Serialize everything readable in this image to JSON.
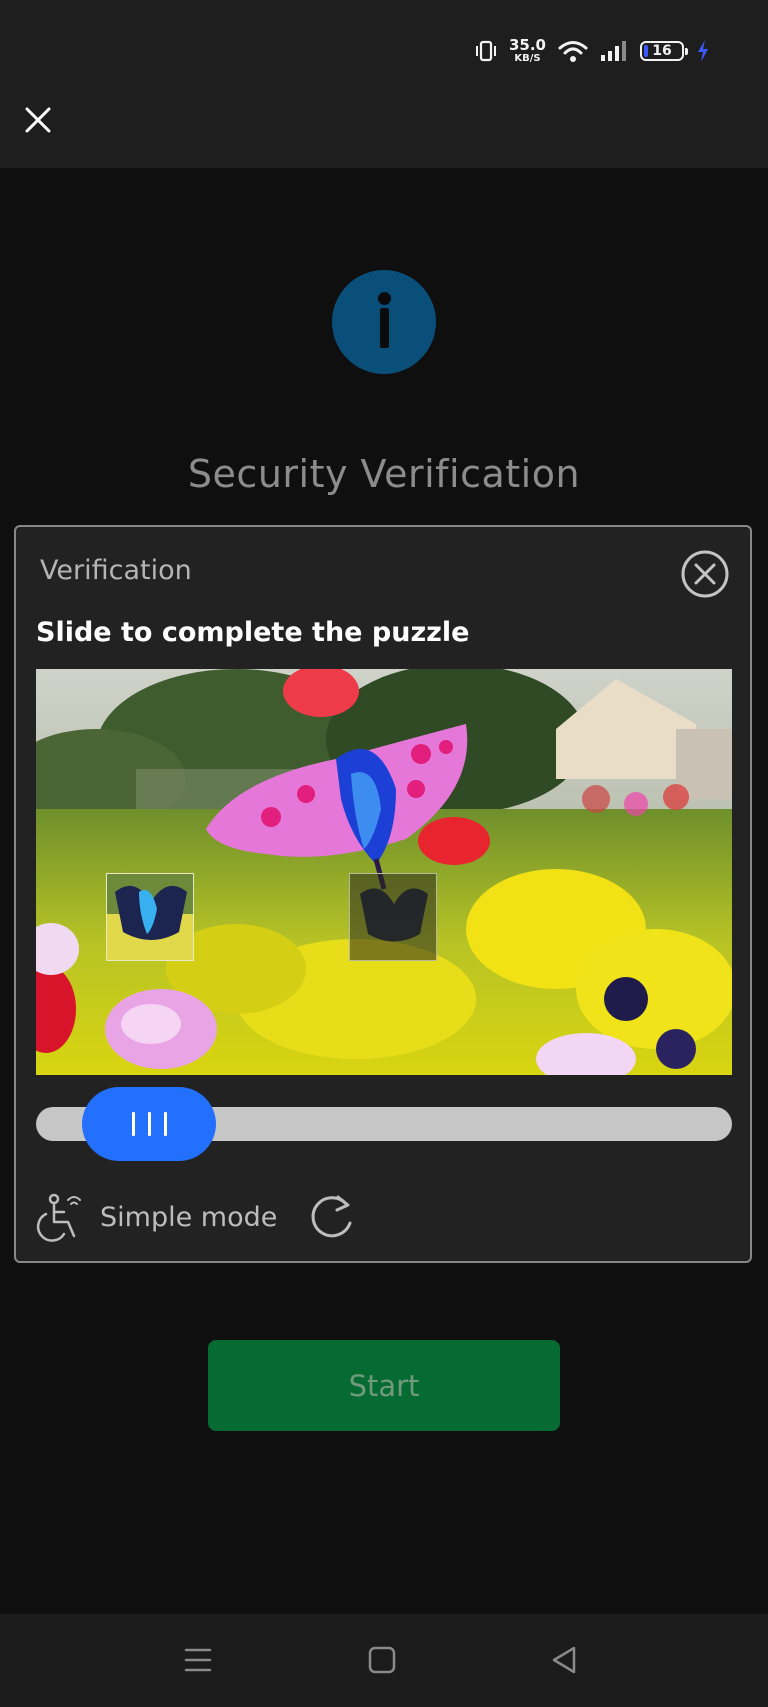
{
  "status_bar": {
    "network_speed_value": "35.0",
    "network_speed_unit": "KB/S",
    "battery_level": "16",
    "icons": [
      "vibrate-icon",
      "wifi-icon",
      "signal-icon",
      "battery-icon",
      "charging-icon"
    ]
  },
  "header": {
    "close_icon": "close-icon"
  },
  "page": {
    "info_icon": "info-icon",
    "title": "Security Verification",
    "start_button_label": "Start"
  },
  "dialog": {
    "title": "Verification",
    "close_icon": "circle-close-icon",
    "instruction": "Slide to complete the puzzle",
    "slider_progress": 0.07,
    "simple_mode_label": "Simple mode",
    "simple_mode_icon": "accessibility-icon",
    "refresh_icon": "refresh-icon"
  },
  "nav_bar": {
    "items": [
      "menu-icon",
      "home-icon",
      "back-icon"
    ]
  },
  "colors": {
    "background": "#0f0f0f",
    "top_bar": "#1e1e1e",
    "dialog_bg": "#222222",
    "info_blue": "#0a4f79",
    "slider_blue": "#2370ff",
    "start_green": "#066a33",
    "battery_accent": "#3d5afe"
  }
}
